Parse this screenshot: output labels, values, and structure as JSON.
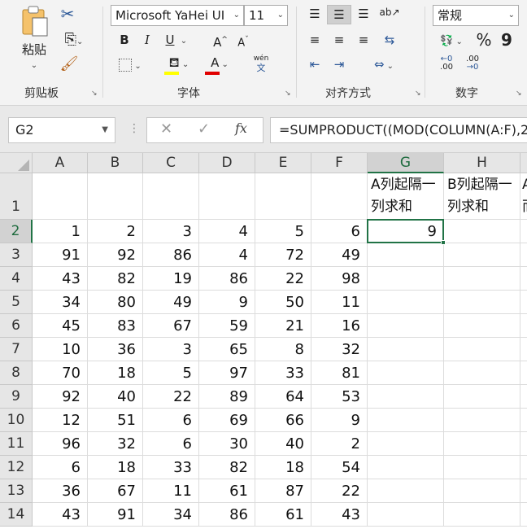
{
  "ribbon": {
    "clipboard": {
      "paste_label": "粘贴",
      "group_label": "剪贴板"
    },
    "font": {
      "font_name": "Microsoft YaHei UI",
      "font_size": "11",
      "bold": "B",
      "italic": "I",
      "underline": "U",
      "grow": "A",
      "shrink": "A",
      "font_color_glyph": "A",
      "phonetic_top": "wén",
      "phonetic_bottom": "文",
      "group_label": "字体"
    },
    "alignment": {
      "group_label": "对齐方式"
    },
    "number": {
      "format": "常规",
      "percent": "%",
      "comma": "9",
      "inc_decimal": ".00",
      "dec_decimal": ".00",
      "group_label": "数字"
    }
  },
  "formula_bar": {
    "name_box": "G2",
    "formula": "=SUMPRODUCT((MOD(COLUMN(A:F),2"
  },
  "grid": {
    "columns": [
      "A",
      "B",
      "C",
      "D",
      "E",
      "F",
      "G",
      "H"
    ],
    "rows": [
      "1",
      "2",
      "3",
      "4",
      "5",
      "6",
      "7",
      "8",
      "9",
      "10",
      "11",
      "12",
      "13",
      "14"
    ],
    "header_texts": {
      "G1": "A列起隔一列求和",
      "H1": "B列起隔一列求和",
      "I1_partial_top": "A",
      "I1_partial_bottom": "而"
    },
    "data": [
      [
        1,
        2,
        3,
        4,
        5,
        6
      ],
      [
        91,
        92,
        86,
        4,
        72,
        49
      ],
      [
        43,
        82,
        19,
        86,
        22,
        98
      ],
      [
        34,
        80,
        49,
        9,
        50,
        11
      ],
      [
        45,
        83,
        67,
        59,
        21,
        16
      ],
      [
        10,
        36,
        3,
        65,
        8,
        32
      ],
      [
        70,
        18,
        5,
        97,
        33,
        81
      ],
      [
        92,
        40,
        22,
        89,
        64,
        53
      ],
      [
        12,
        51,
        6,
        69,
        66,
        9
      ],
      [
        96,
        32,
        6,
        30,
        40,
        2
      ],
      [
        6,
        18,
        33,
        82,
        18,
        54
      ],
      [
        36,
        67,
        11,
        61,
        87,
        22
      ],
      [
        43,
        91,
        34,
        86,
        61,
        43
      ]
    ],
    "g2_value": "9",
    "selected": "G2"
  },
  "colors": {
    "accent": "#217346",
    "selected_header": "#d2d2d2"
  }
}
